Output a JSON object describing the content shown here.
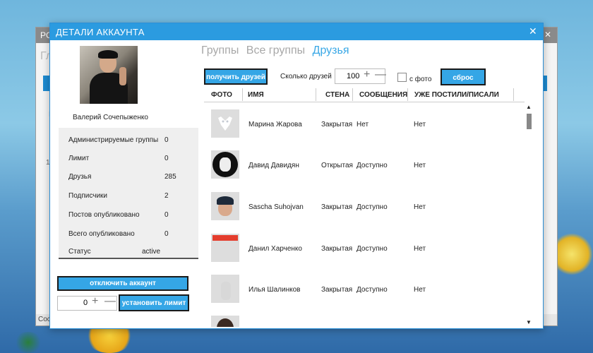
{
  "background_window": {
    "title": "PC",
    "heading": "Гл",
    "status": "Сост",
    "row_label_1": "I",
    "row_label_2": "1",
    "close_glyph": "✕"
  },
  "dialog": {
    "title": "ДЕТАЛИ АККАУНТА",
    "close_glyph": "✕"
  },
  "profile": {
    "name": "Валерий Сочепыженко",
    "stats": [
      {
        "label": "Администрируемые группы",
        "value": "0"
      },
      {
        "label": "Лимит",
        "value": "0"
      },
      {
        "label": "Друзья",
        "value": "285"
      },
      {
        "label": "Подписчики",
        "value": "2"
      },
      {
        "label": "Постов опубликовано",
        "value": "0"
      },
      {
        "label": "Всего опубликовано",
        "value": "0"
      },
      {
        "label": "Статус",
        "value": "active"
      }
    ],
    "disable_button": "отключить аккаунт",
    "limit_value": "0",
    "set_limit_button": "установить лимит"
  },
  "tabs": [
    {
      "label": "Группы",
      "active": false
    },
    {
      "label": "Все группы",
      "active": false
    },
    {
      "label": "Друзья",
      "active": true
    }
  ],
  "controls": {
    "get_friends_button": "получить друзей",
    "count_label": "Сколько друзей",
    "count_value": "100",
    "photo_checkbox_label": "с фото",
    "photo_checked": false,
    "reset_button": "сброс"
  },
  "table": {
    "columns": [
      "ФОТО",
      "ИМЯ",
      "СТЕНА",
      "СООБЩЕНИЯ",
      "УЖЕ ПОСТИЛИ/ПИСАЛИ"
    ],
    "rows": [
      {
        "name": "Марина Жарова",
        "wall": "Закрытая",
        "messages": "Нет",
        "posted": "Нет",
        "photo": "vk-default"
      },
      {
        "name": "Давид Давидян",
        "wall": "Открытая",
        "messages": "Доступно",
        "posted": "Нет",
        "photo": "dog-logo"
      },
      {
        "name": "Sascha Suhojvan",
        "wall": "Закрытая",
        "messages": "Доступно",
        "posted": "Нет",
        "photo": "man-portrait"
      },
      {
        "name": "Данил Харченко",
        "wall": "Закрытая",
        "messages": "Доступно",
        "posted": "Нет",
        "photo": "cat-meme"
      },
      {
        "name": "Илья Шалинков",
        "wall": "Закрытая",
        "messages": "Доступно",
        "posted": "Нет",
        "photo": "dark-portrait"
      },
      {
        "name": "",
        "wall": "",
        "messages": "",
        "posted": "",
        "photo": "girl-portrait"
      }
    ]
  },
  "icons": {
    "plus": "+",
    "minus": "—",
    "scroll_up": "▲",
    "scroll_down": "▼"
  },
  "colors": {
    "accent": "#2b9be0",
    "button": "#35a6e6",
    "active_tab": "#3aa8e6"
  }
}
